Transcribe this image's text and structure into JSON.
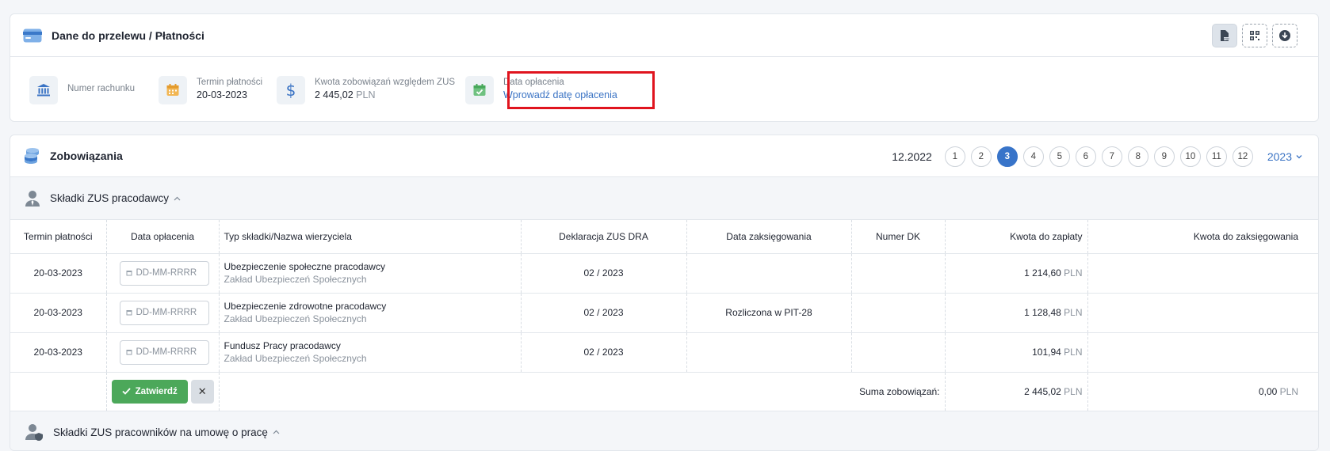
{
  "payment": {
    "title": "Dane do przelewu / Płatności",
    "items": [
      {
        "label": "Numer rachunku",
        "value": ""
      },
      {
        "label": "Termin płatności",
        "value": "20-03-2023"
      },
      {
        "label": "Kwota zobowiązań względem ZUS",
        "value": "2 445,02",
        "currency": "PLN"
      },
      {
        "label": "Data opłacenia",
        "link": "Wprowadź datę opłacenia"
      }
    ]
  },
  "obligations": {
    "title": "Zobowiązania",
    "period": "12.2022",
    "months": [
      "1",
      "2",
      "3",
      "4",
      "5",
      "6",
      "7",
      "8",
      "9",
      "10",
      "11",
      "12"
    ],
    "active_month": "3",
    "year": "2023"
  },
  "section1": {
    "title": "Składki ZUS pracodawcy",
    "columns": [
      "Termin płatności",
      "Data opłacenia",
      "Typ składki/Nazwa wierzyciela",
      "Deklaracja ZUS DRA",
      "Data zaksięgowania",
      "Numer DK",
      "Kwota do zapłaty",
      "Kwota do zaksięgowania"
    ],
    "date_placeholder": "DD-MM-RRRR",
    "rows": [
      {
        "due": "20-03-2023",
        "name": "Ubezpieczenie społeczne pracodawcy",
        "creditor": "Zakład Ubezpieczeń Społecznych",
        "declaration": "02 / 2023",
        "posting": "",
        "dk": "",
        "amount": "1 214,60",
        "currency": "PLN"
      },
      {
        "due": "20-03-2023",
        "name": "Ubezpieczenie zdrowotne pracodawcy",
        "creditor": "Zakład Ubezpieczeń Społecznych",
        "declaration": "02 / 2023",
        "posting": "Rozliczona w PIT-28",
        "dk": "",
        "amount": "1 128,48",
        "currency": "PLN"
      },
      {
        "due": "20-03-2023",
        "name": "Fundusz Pracy pracodawcy",
        "creditor": "Zakład Ubezpieczeń Społecznych",
        "declaration": "02 / 2023",
        "posting": "",
        "dk": "",
        "amount": "101,94",
        "currency": "PLN"
      }
    ],
    "confirm_label": "Zatwierdź",
    "cancel_label": "✕",
    "sum_label": "Suma zobowiązań:",
    "sum_amount": "2 445,02",
    "sum_posted": "0,00",
    "currency": "PLN"
  },
  "section2": {
    "title": "Składki ZUS pracowników na umowę o pracę"
  },
  "colors": {
    "accent": "#3874c9",
    "success": "#4ca85a",
    "highlight": "#e0141e"
  }
}
